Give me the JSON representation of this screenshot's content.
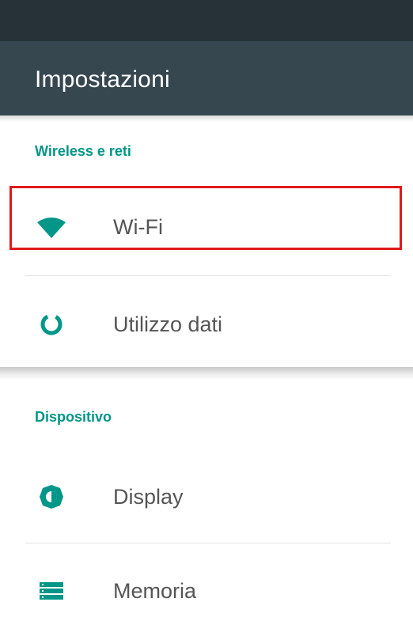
{
  "app_bar": {
    "title": "Impostazioni"
  },
  "sections": [
    {
      "header": "Wireless e reti",
      "items": [
        {
          "label": "Wi-Fi",
          "icon": "wifi-icon"
        },
        {
          "label": "Utilizzo dati",
          "icon": "data-usage-icon"
        }
      ]
    },
    {
      "header": "Dispositivo",
      "items": [
        {
          "label": "Display",
          "icon": "brightness-icon"
        },
        {
          "label": "Memoria",
          "icon": "storage-icon"
        }
      ]
    }
  ],
  "colors": {
    "status_bar": "#263238",
    "app_bar": "#37474f",
    "accent": "#009688",
    "highlight": "#e11919"
  }
}
